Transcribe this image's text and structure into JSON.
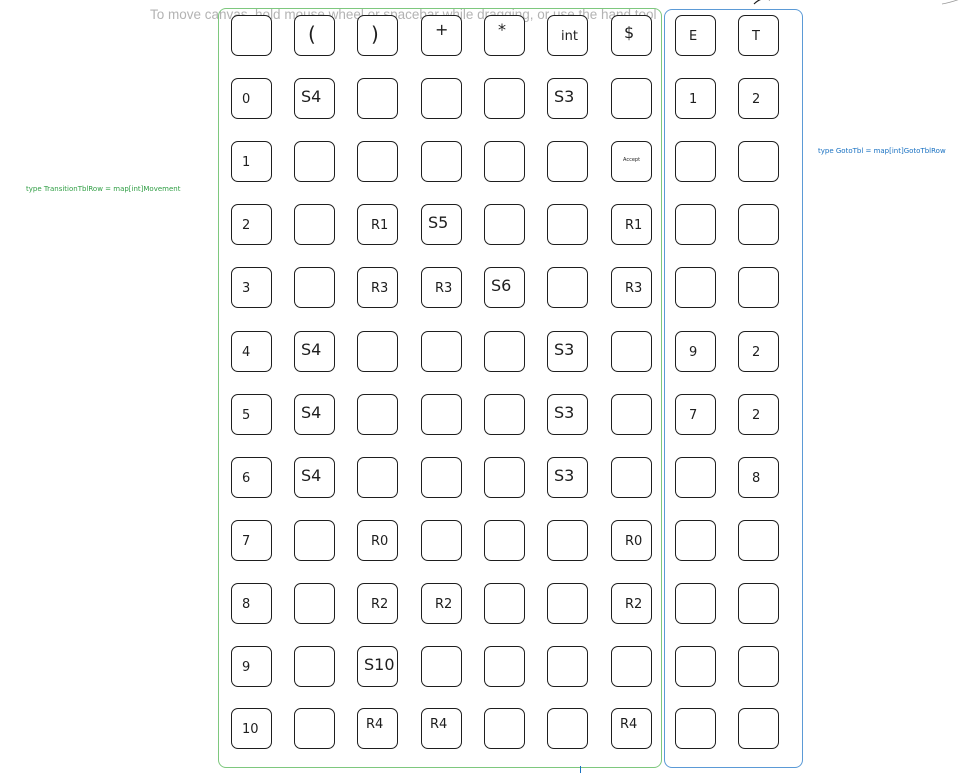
{
  "canvas": {
    "hint": "To move canvas, hold mouse wheel or spacebar while dragging, or use the hand tool",
    "notes": {
      "action": "type TransitionTblRow = map[int]Movement",
      "goto": "type GotoTbl = map[int]GotoTblRow"
    },
    "colors": {
      "action_frame": "#7ec87e",
      "goto_frame": "#5b9ad6",
      "action_note": "#2f9e44",
      "goto_note": "#1971c2"
    }
  },
  "table": {
    "header": [
      "",
      "(",
      ")",
      "+",
      "*",
      "int",
      "$",
      "E",
      "T"
    ],
    "rows": [
      [
        "0",
        "S4",
        "",
        "",
        "",
        "S3",
        "",
        "1",
        "2"
      ],
      [
        "1",
        "",
        "",
        "",
        "",
        "",
        "Accept",
        "",
        ""
      ],
      [
        "2",
        "",
        "R1",
        "S5",
        "",
        "",
        "R1",
        "",
        ""
      ],
      [
        "3",
        "",
        "R3",
        "R3",
        "S6",
        "",
        "R3",
        "",
        ""
      ],
      [
        "4",
        "S4",
        "",
        "",
        "",
        "S3",
        "",
        "9",
        "2"
      ],
      [
        "5",
        "S4",
        "",
        "",
        "",
        "S3",
        "",
        "7",
        "2"
      ],
      [
        "6",
        "S4",
        "",
        "",
        "",
        "S3",
        "",
        "",
        "8"
      ],
      [
        "7",
        "",
        "R0",
        "",
        "",
        "",
        "R0",
        "",
        ""
      ],
      [
        "8",
        "",
        "R2",
        "R2",
        "",
        "",
        "R2",
        "",
        ""
      ],
      [
        "9",
        "",
        "S10",
        "",
        "",
        "",
        "",
        "",
        ""
      ],
      [
        "10",
        "",
        "R4",
        "R4",
        "",
        "",
        "R4",
        "",
        ""
      ]
    ]
  }
}
